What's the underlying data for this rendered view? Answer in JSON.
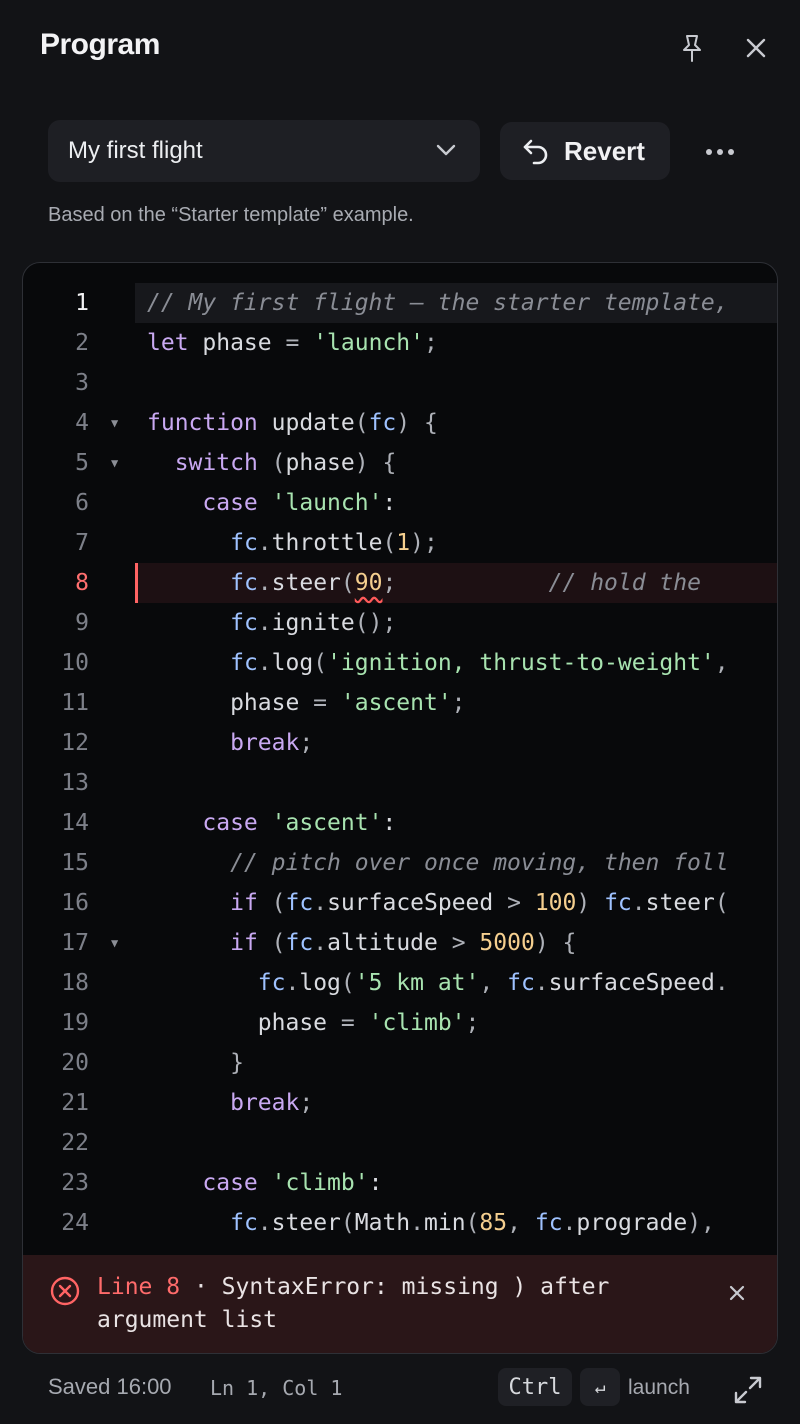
{
  "header": {
    "title": "Program"
  },
  "toolbar": {
    "program_name": "My first flight",
    "revert_label": "Revert"
  },
  "based_on": "Based on the “Starter template” example.",
  "editor": {
    "lines": [
      {
        "n": "1",
        "text": "// My first flight — the starter template,"
      },
      {
        "n": "2",
        "text": "let phase = 'launch';"
      },
      {
        "n": "3",
        "text": ""
      },
      {
        "n": "4",
        "text": "function update(fc) {"
      },
      {
        "n": "5",
        "text": "  switch (phase) {"
      },
      {
        "n": "6",
        "text": "    case 'launch':"
      },
      {
        "n": "7",
        "text": "      fc.throttle(1);"
      },
      {
        "n": "8",
        "text": "      fc.steer(90;           // hold the"
      },
      {
        "n": "9",
        "text": "      fc.ignite();"
      },
      {
        "n": "10",
        "text": "      fc.log('ignition, thrust-to-weight',"
      },
      {
        "n": "11",
        "text": "      phase = 'ascent';"
      },
      {
        "n": "12",
        "text": "      break;"
      },
      {
        "n": "13",
        "text": ""
      },
      {
        "n": "14",
        "text": "    case 'ascent':"
      },
      {
        "n": "15",
        "text": "      // pitch over once moving, then foll"
      },
      {
        "n": "16",
        "text": "      if (fc.surfaceSpeed > 100) fc.steer("
      },
      {
        "n": "17",
        "text": "      if (fc.altitude > 5000) {"
      },
      {
        "n": "18",
        "text": "        fc.log('5 km at', fc.surfaceSpeed."
      },
      {
        "n": "19",
        "text": "        phase = 'climb';"
      },
      {
        "n": "20",
        "text": "      }"
      },
      {
        "n": "21",
        "text": "      break;"
      },
      {
        "n": "22",
        "text": ""
      },
      {
        "n": "23",
        "text": "    case 'climb':"
      },
      {
        "n": "24",
        "text": "      fc.steer(Math.min(85, fc.prograde),"
      }
    ],
    "active_line": 1,
    "error_line": 8
  },
  "error": {
    "line_label": "Line 8",
    "separator": "·",
    "message": "SyntaxError: missing ) after argument list"
  },
  "status": {
    "saved": "Saved 16:00",
    "cursor": "Ln 1, Col 1",
    "key1": "Ctrl",
    "key2": "↵",
    "shortcut_action": "launch"
  },
  "colors": {
    "background": "#121316",
    "editor_bg": "#08090b",
    "error": "#ff6464",
    "keyword": "#c9a9f2",
    "string": "#a8e3b0",
    "number": "#f5cf8f"
  }
}
